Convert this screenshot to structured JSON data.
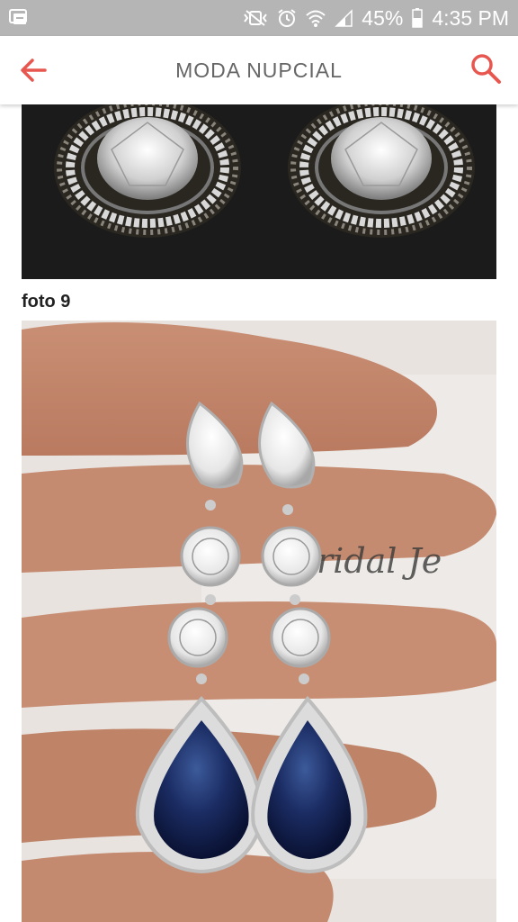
{
  "status_bar": {
    "battery": "45%",
    "time": "4:35 PM",
    "icons": [
      "notification-icon",
      "vibrate-icon",
      "alarm-icon",
      "wifi-icon",
      "signal-icon",
      "battery-icon"
    ]
  },
  "app_bar": {
    "title": "MODA NUPCIAL",
    "back_icon": "back-arrow-icon",
    "search_icon": "search-icon",
    "accent_color": "#e8574f"
  },
  "gallery": {
    "caption": "foto 9",
    "watermark": "ridal Je"
  }
}
